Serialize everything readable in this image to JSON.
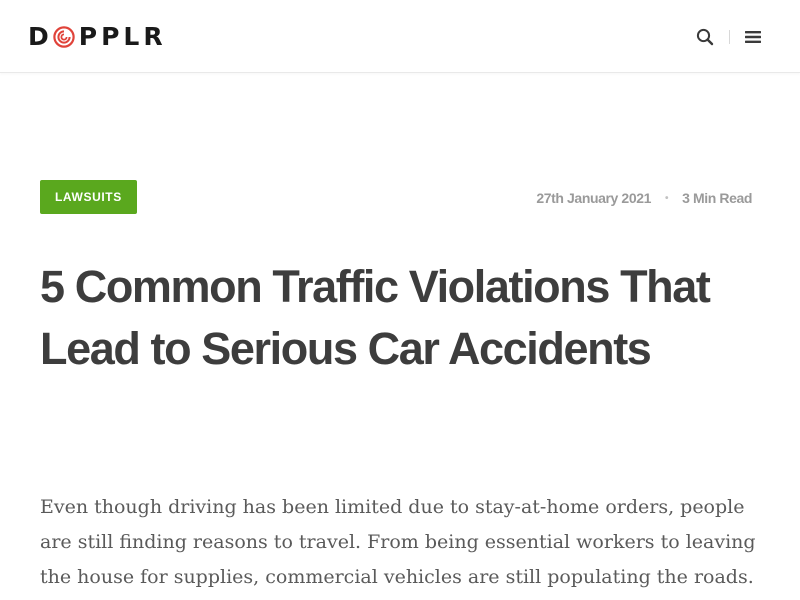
{
  "header": {
    "logo_text_before": "D",
    "logo_text_after": "PPLR",
    "search_icon": "search-icon",
    "menu_icon": "hamburger-menu-icon"
  },
  "post": {
    "category": "LAWSUITS",
    "date": "27th January 2021",
    "meta_separator": "•",
    "read_time": "3 Min Read",
    "title": "5 Common Traffic Violations That Lead to Serious Car Accidents",
    "intro": "Even though driving has been limited due to stay-at-home orders, people are still finding reasons to travel. From being essential workers to leaving the house for supplies, commercial vehicles are still populating the roads."
  },
  "colors": {
    "accent_green": "#5aa81e",
    "logo_red": "#e0433a",
    "title_text": "#3d3d3d",
    "meta_text": "#9a9a9a",
    "body_text": "#5a5a5a"
  }
}
